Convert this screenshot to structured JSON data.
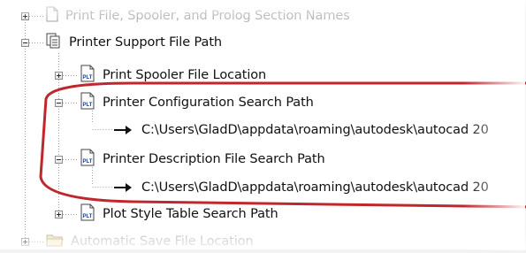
{
  "tree": {
    "items": [
      {
        "label": "Print File, Spooler, and Prolog Section Names",
        "icon": "blank-page-icon",
        "state": "collapsed"
      },
      {
        "label": "Printer Support File Path",
        "icon": "documents-icon",
        "state": "expanded"
      },
      {
        "label": "Print Spooler File Location",
        "icon": "plt-file-icon",
        "state": "collapsed"
      },
      {
        "label": "Printer Configuration Search Path",
        "icon": "plt-file-icon",
        "state": "expanded"
      },
      {
        "label": "C:\\Users\\GladD\\appdata\\roaming\\autodesk\\autocad 20",
        "icon": "arrow-right-icon",
        "state": "leaf"
      },
      {
        "label": "Printer Description File Search Path",
        "icon": "plt-file-icon",
        "state": "expanded"
      },
      {
        "label": "C:\\Users\\GladD\\appdata\\roaming\\autodesk\\autocad 20",
        "icon": "arrow-right-icon",
        "state": "leaf"
      },
      {
        "label": "Plot Style Table Search Path",
        "icon": "plt-file-icon",
        "state": "collapsed"
      },
      {
        "label": "Automatic Save File Location",
        "icon": "folder-icon",
        "state": "collapsed"
      }
    ]
  },
  "icons": {
    "plt_text": "PLT"
  },
  "colors": {
    "highlight": "#c0272d",
    "tree_line": "#a0a0a0",
    "faded_text": "#7a7a7a"
  }
}
